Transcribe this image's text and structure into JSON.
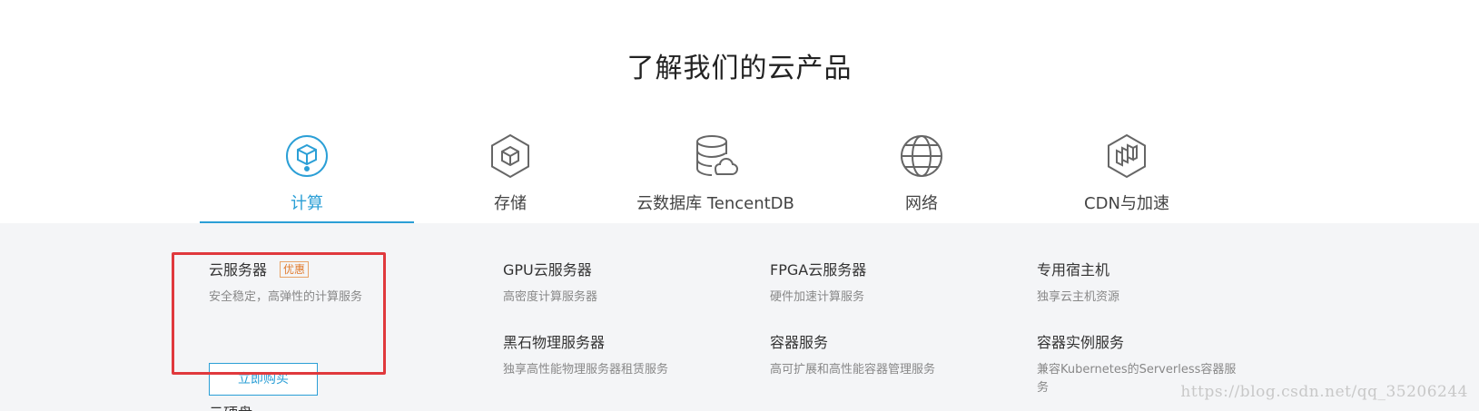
{
  "heading": "了解我们的云产品",
  "tabs": [
    {
      "label": "计算",
      "icon": "cube-circle-icon",
      "active": true
    },
    {
      "label": "存储",
      "icon": "cube-hexagon-icon",
      "active": false
    },
    {
      "label": "云数据库 TencentDB",
      "icon": "database-cloud-icon",
      "active": false
    },
    {
      "label": "网络",
      "icon": "globe-icon",
      "active": false
    },
    {
      "label": "CDN与加速",
      "icon": "cdn-hexagon-icon",
      "active": false
    }
  ],
  "products": [
    {
      "name": "云服务器",
      "badge": "优惠",
      "desc": "安全稳定，高弹性的计算服务",
      "button": "立即购买"
    },
    {
      "name": "GPU云服务器",
      "desc": "高密度计算服务器"
    },
    {
      "name": "FPGA云服务器",
      "desc": "硬件加速计算服务"
    },
    {
      "name": "专用宿主机",
      "desc": "独享云主机资源"
    },
    {
      "name": "黑石物理服务器",
      "desc": "独享高性能物理服务器租赁服务"
    },
    {
      "name": "容器服务",
      "desc": "高可扩展和高性能容器管理服务"
    },
    {
      "name": "容器实例服务",
      "desc": "兼容Kubernetes的Serverless容器服务"
    },
    {
      "name": "云硬盘"
    }
  ],
  "watermark": "https://blog.csdn.net/qq_35206244",
  "colors": {
    "accent": "#2b9fd6",
    "highlight_box": "#e0393d",
    "badge": "#e07b2e",
    "panel_bg": "#f4f5f7"
  }
}
